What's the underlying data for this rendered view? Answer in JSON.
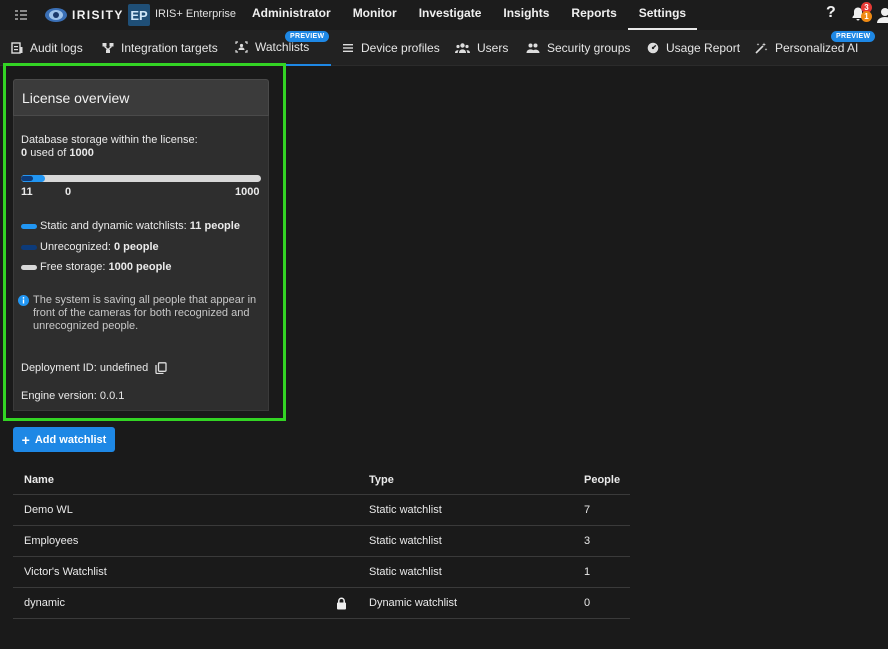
{
  "header": {
    "logo_text": "IRISITY",
    "edition_badge": "EP",
    "edition_name": "IRIS+ Enterprise",
    "nav": [
      {
        "label": "Administrator"
      },
      {
        "label": "Monitor"
      },
      {
        "label": "Investigate"
      },
      {
        "label": "Insights"
      },
      {
        "label": "Reports"
      },
      {
        "label": "Settings",
        "active": true
      }
    ],
    "help_label": "?",
    "notification_count": "3",
    "notification_count_2": "1"
  },
  "subnav": {
    "tabs": [
      {
        "label": "Audit logs",
        "icon": "audit-log-icon"
      },
      {
        "label": "Integration targets",
        "icon": "integration-icon"
      },
      {
        "label": "Watchlists",
        "icon": "watchlist-icon",
        "active": true,
        "badge": "PREVIEW"
      },
      {
        "label": "Device profiles",
        "icon": "device-profile-icon"
      },
      {
        "label": "Users",
        "icon": "users-icon"
      },
      {
        "label": "Security groups",
        "icon": "security-groups-icon"
      },
      {
        "label": "Usage Report",
        "icon": "usage-report-icon"
      },
      {
        "label": "Personalized AI",
        "icon": "ai-icon",
        "badge": "PREVIEW"
      }
    ]
  },
  "license": {
    "title": "License overview",
    "storage_label": "Database storage within the license:",
    "used_value": "0",
    "used_suffix": "used of",
    "total_value": "1000",
    "bar_watchlist_fraction": 0.011,
    "bar_label_left": "11",
    "bar_label_mid": "0",
    "bar_label_right": "1000",
    "legend": [
      {
        "label": "Static and dynamic watchlists:",
        "value": "11 people",
        "color": "#2196f3"
      },
      {
        "label": "Unrecognized:",
        "value": "0 people",
        "color": "#0d3b7a"
      },
      {
        "label": "Free storage:",
        "value": "1000 people",
        "color": "#d8d8d8"
      }
    ],
    "info_text": "The system is saving all people that appear in front of the cameras for both recognized and unrecognized people.",
    "deployment_label": "Deployment ID:",
    "deployment_value": "undefined",
    "engine_label": "Engine version:",
    "engine_value": "0.0.1"
  },
  "add_button_label": "Add watchlist",
  "table": {
    "headers": {
      "name": "Name",
      "type": "Type",
      "people": "People"
    },
    "rows": [
      {
        "name": "Demo WL",
        "type": "Static watchlist",
        "people": "7",
        "locked": false
      },
      {
        "name": "Employees",
        "type": "Static watchlist",
        "people": "3",
        "locked": false
      },
      {
        "name": "Victor's Watchlist",
        "type": "Static watchlist",
        "people": "1",
        "locked": false
      },
      {
        "name": "dynamic",
        "type": "Dynamic watchlist",
        "people": "0",
        "locked": true
      }
    ]
  },
  "colors": {
    "accent": "#1e88e5",
    "highlight": "#33d424",
    "notify_red": "#e53935",
    "notify_orange": "#ef8a13"
  }
}
